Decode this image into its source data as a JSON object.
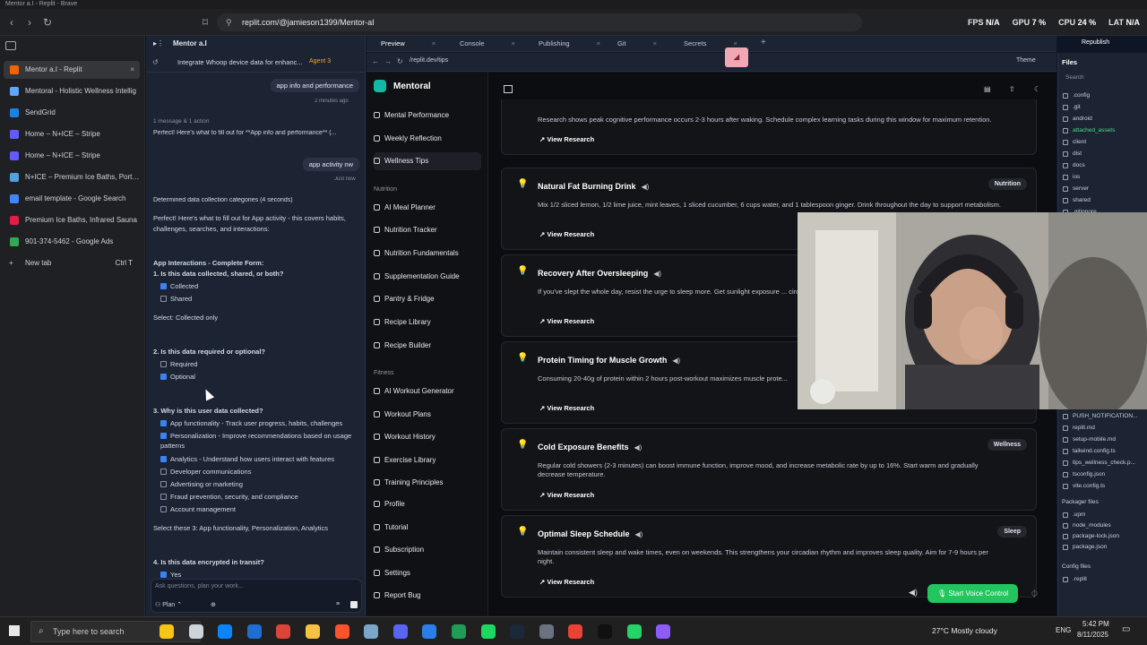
{
  "window_title": "Mentor a.I - Replit - Brave",
  "browser": {
    "url": "replit.com/@jamieson1399/Mentor-aI",
    "stats": {
      "fps_label": "FPS",
      "fps": "N/A",
      "gpu_label": "GPU",
      "gpu": "7 %",
      "cpu_label": "CPU",
      "cpu": "24 %",
      "lat_label": "LAT",
      "lat": "N/A"
    },
    "tabs": [
      {
        "title": "Mentor a.I - Replit",
        "color": "#f26207"
      },
      {
        "title": "Mentoral - Holistic Wellness Intellig",
        "color": "#60a5fa"
      },
      {
        "title": "SendGrid",
        "color": "#1a82e2"
      },
      {
        "title": "Home – N+ICE – Stripe",
        "color": "#635bff"
      },
      {
        "title": "Home – N+ICE – Stripe",
        "color": "#635bff"
      },
      {
        "title": "N+ICE – Premium Ice Baths, Portabl",
        "color": "#4fa3e0"
      },
      {
        "title": "email template - Google Search",
        "color": "#4285f4"
      },
      {
        "title": "Premium Ice Baths, Infrared Sauna",
        "color": "#e11d48"
      },
      {
        "title": "901-374-5462 - Google Ads",
        "color": "#34a853"
      }
    ],
    "new_tab": {
      "label": "New tab",
      "shortcut": "Ctrl T"
    }
  },
  "chat": {
    "agent_label": "Mentor a.I",
    "header_title": "Integrate Whoop device data for enhanc...",
    "agent_badge": "Agent 3",
    "bubble1": "app info and performance",
    "bubble1_time": "2 minutes ago",
    "summary_line": "1 message & 1 action",
    "reply_preview": "Perfect! Here's what to fill out for **App info and performance** (...",
    "bubble2": "app activity nw",
    "bubble2_time": "Just now",
    "determined": "Determined data collection categories (4 seconds)",
    "intro1": "Perfect! Here's what to fill out for App activity - this covers habits,",
    "intro2": "challenges, searches, and interactions:",
    "section_title": "App Interactions - Complete Form:",
    "q1": "1. Is this data collected, shared, or both?",
    "q1_opts": [
      {
        "label": "Collected",
        "checked": true
      },
      {
        "label": "Shared",
        "checked": false
      }
    ],
    "q1_select": "Select: Collected only",
    "q2": "2. Is this data required or optional?",
    "q2_opts": [
      {
        "label": "Required",
        "checked": false
      },
      {
        "label": "Optional",
        "checked": true
      }
    ],
    "q3": "3. Why is this user data collected?",
    "q3_opts": [
      {
        "label": "App functionality - Track user progress, habits, challenges",
        "checked": true
      },
      {
        "label": "Personalization - Improve recommendations based on usage",
        "checked": true
      },
      {
        "label": "patterns",
        "checked": null
      },
      {
        "label": "Analytics - Understand how users interact with features",
        "checked": true
      },
      {
        "label": "Developer communications",
        "checked": false
      },
      {
        "label": "Advertising or marketing",
        "checked": false
      },
      {
        "label": "Fraud prevention, security, and compliance",
        "checked": false
      },
      {
        "label": "Account management",
        "checked": false
      }
    ],
    "q3_select": "Select these 3: App functionality, Personalization, Analytics",
    "q4": "4. Is this data encrypted in transit?",
    "q4_opt": "Yes",
    "input_placeholder": "Ask questions, plan your work...",
    "plan_label": "Plan"
  },
  "workspace_tabs": [
    {
      "label": "Preview",
      "active": true
    },
    {
      "label": "Console",
      "active": false
    },
    {
      "label": "Publishing",
      "active": false
    },
    {
      "label": "Git",
      "active": false
    },
    {
      "label": "Secrets",
      "active": false
    }
  ],
  "preview_url": "/replit.dev/tips",
  "theme_label": "Theme",
  "republish_label": "Republish",
  "app": {
    "brand": "Mentoral",
    "nav_top": [
      "Mental Performance",
      "Weekly Reflection",
      "Wellness Tips"
    ],
    "nav_active": "Wellness Tips",
    "section_nutrition": "Nutrition",
    "nav_nutrition": [
      "AI Meal Planner",
      "Nutrition Tracker",
      "Nutrition Fundamentals",
      "Supplementation Guide",
      "Pantry & Fridge",
      "Recipe Library",
      "Recipe Builder"
    ],
    "section_fitness": "Fitness",
    "nav_fitness": [
      "AI Workout Generator",
      "Workout Plans",
      "Workout History",
      "Exercise Library",
      "Training Principles"
    ],
    "nav_bottom": [
      "Profile",
      "Tutorial",
      "Subscription",
      "Settings",
      "Report Bug"
    ],
    "top_text": "Research shows peak cognitive performance occurs 2-3 hours after waking. Schedule complex learning tasks during this window for maximum retention.",
    "view_research": "View Research",
    "cards": [
      {
        "title": "Natural Fat Burning Drink",
        "badge": "Nutrition",
        "desc": "Mix 1/2 sliced lemon, 1/2 lime juice, mint leaves, 1 sliced cucumber, 6 cups water, and 1 tablespoon ginger. Drink throughout the day to support metabolism."
      },
      {
        "title": "Recovery After Oversleeping",
        "badge": "",
        "desc": "If you've slept the whole day, resist the urge to sleep more. Get sunlight exposure ... circadian rhythm."
      },
      {
        "title": "Protein Timing for Muscle Growth",
        "badge": "",
        "desc": "Consuming 20-40g of protein within 2 hours post-workout maximizes muscle prote..."
      },
      {
        "title": "Cold Exposure Benefits",
        "badge": "Wellness",
        "desc": "Regular cold showers (2-3 minutes) can boost immune function, improve mood, and increase metabolic rate by up to 16%. Start warm and gradually decrease temperature."
      },
      {
        "title": "Optimal Sleep Schedule",
        "badge": "Sleep",
        "desc": "Maintain consistent sleep and wake times, even on weekends. This strengthens your circadian rhythm and improves sleep quality. Aim for 7-9 hours per night."
      }
    ],
    "voice_button": "Start Voice Control"
  },
  "files": {
    "title": "Files",
    "search": "Search",
    "items": [
      ".config",
      ".git",
      "android",
      "attached_assets",
      "client",
      "dist",
      "docs",
      "ios",
      "server",
      "shared",
      ".gitignore"
    ],
    "items_lower": [
      "PUSH_NOTIFICATION...",
      "replit.md",
      "setup-mobile.md",
      "tailwind.config.ts",
      "tips_wellness_check.p...",
      "tsconfig.json",
      "vite.config.ts"
    ],
    "packager_title": "Packager files",
    "packager": [
      ".upm",
      "node_modules",
      "package-lock.json",
      "package.json"
    ],
    "config_title": "Config files",
    "config": [
      ".replit"
    ]
  },
  "taskbar": {
    "search_placeholder": "Type here to search",
    "weather": "27°C  Mostly cloudy",
    "lang": "ENG",
    "time": "5:42 PM",
    "date": "8/11/2025"
  }
}
